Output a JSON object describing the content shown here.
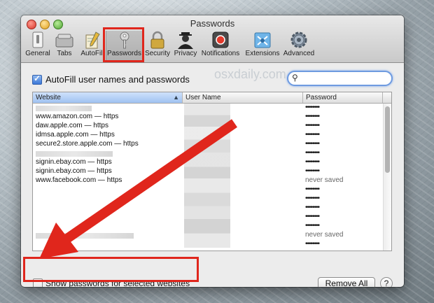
{
  "window": {
    "title": "Passwords"
  },
  "toolbar": {
    "items": [
      {
        "label": "General",
        "icon": "general-switch-icon"
      },
      {
        "label": "Tabs",
        "icon": "tabs-icon"
      },
      {
        "label": "AutoFill",
        "icon": "autofill-pencil-icon"
      },
      {
        "label": "Passwords",
        "icon": "key-icon",
        "selected": true
      },
      {
        "label": "Security",
        "icon": "lock-icon"
      },
      {
        "label": "Privacy",
        "icon": "privacy-silhouette-icon"
      },
      {
        "label": "Notifications",
        "icon": "notifications-icon"
      },
      {
        "label": "Extensions",
        "icon": "extensions-puzzle-icon"
      },
      {
        "label": "Advanced",
        "icon": "gear-icon"
      }
    ]
  },
  "autofill": {
    "label": "AutoFill user names and passwords",
    "checked": true
  },
  "search": {
    "placeholder": "",
    "value": ""
  },
  "watermark": "osxdaily.com",
  "table": {
    "columns": {
      "website": "Website",
      "username": "User Name",
      "password": "Password"
    },
    "rows": [
      {
        "site": "",
        "password": "••••••••"
      },
      {
        "site": "www.amazon.com — https",
        "password": "••••••••"
      },
      {
        "site": "daw.apple.com — https",
        "password": "••••••••"
      },
      {
        "site": "idmsa.apple.com — https",
        "password": "••••••••"
      },
      {
        "site": "secure2.store.apple.com — https",
        "password": "••••••••"
      },
      {
        "site": "",
        "password": "••••••••"
      },
      {
        "site": "signin.ebay.com — https",
        "password": "••••••••"
      },
      {
        "site": "signin.ebay.com — https",
        "password": "••••••••"
      },
      {
        "site": "www.facebook.com — https",
        "password": "never saved"
      },
      {
        "site": "",
        "password": "••••••••"
      },
      {
        "site": "",
        "password": "••••••••"
      },
      {
        "site": "",
        "password": "••••••••"
      },
      {
        "site": "",
        "password": "••••••••"
      },
      {
        "site": "",
        "password": "••••••••"
      },
      {
        "site": "",
        "password": "never saved"
      },
      {
        "site": "",
        "password": "••••••••"
      }
    ]
  },
  "show_passwords": {
    "label": "Show passwords for selected websites",
    "checked": false
  },
  "buttons": {
    "remove_all": "Remove All",
    "help": "?"
  },
  "colors": {
    "annotation_red": "#e0261c",
    "accent_blue": "#3c78d8"
  }
}
